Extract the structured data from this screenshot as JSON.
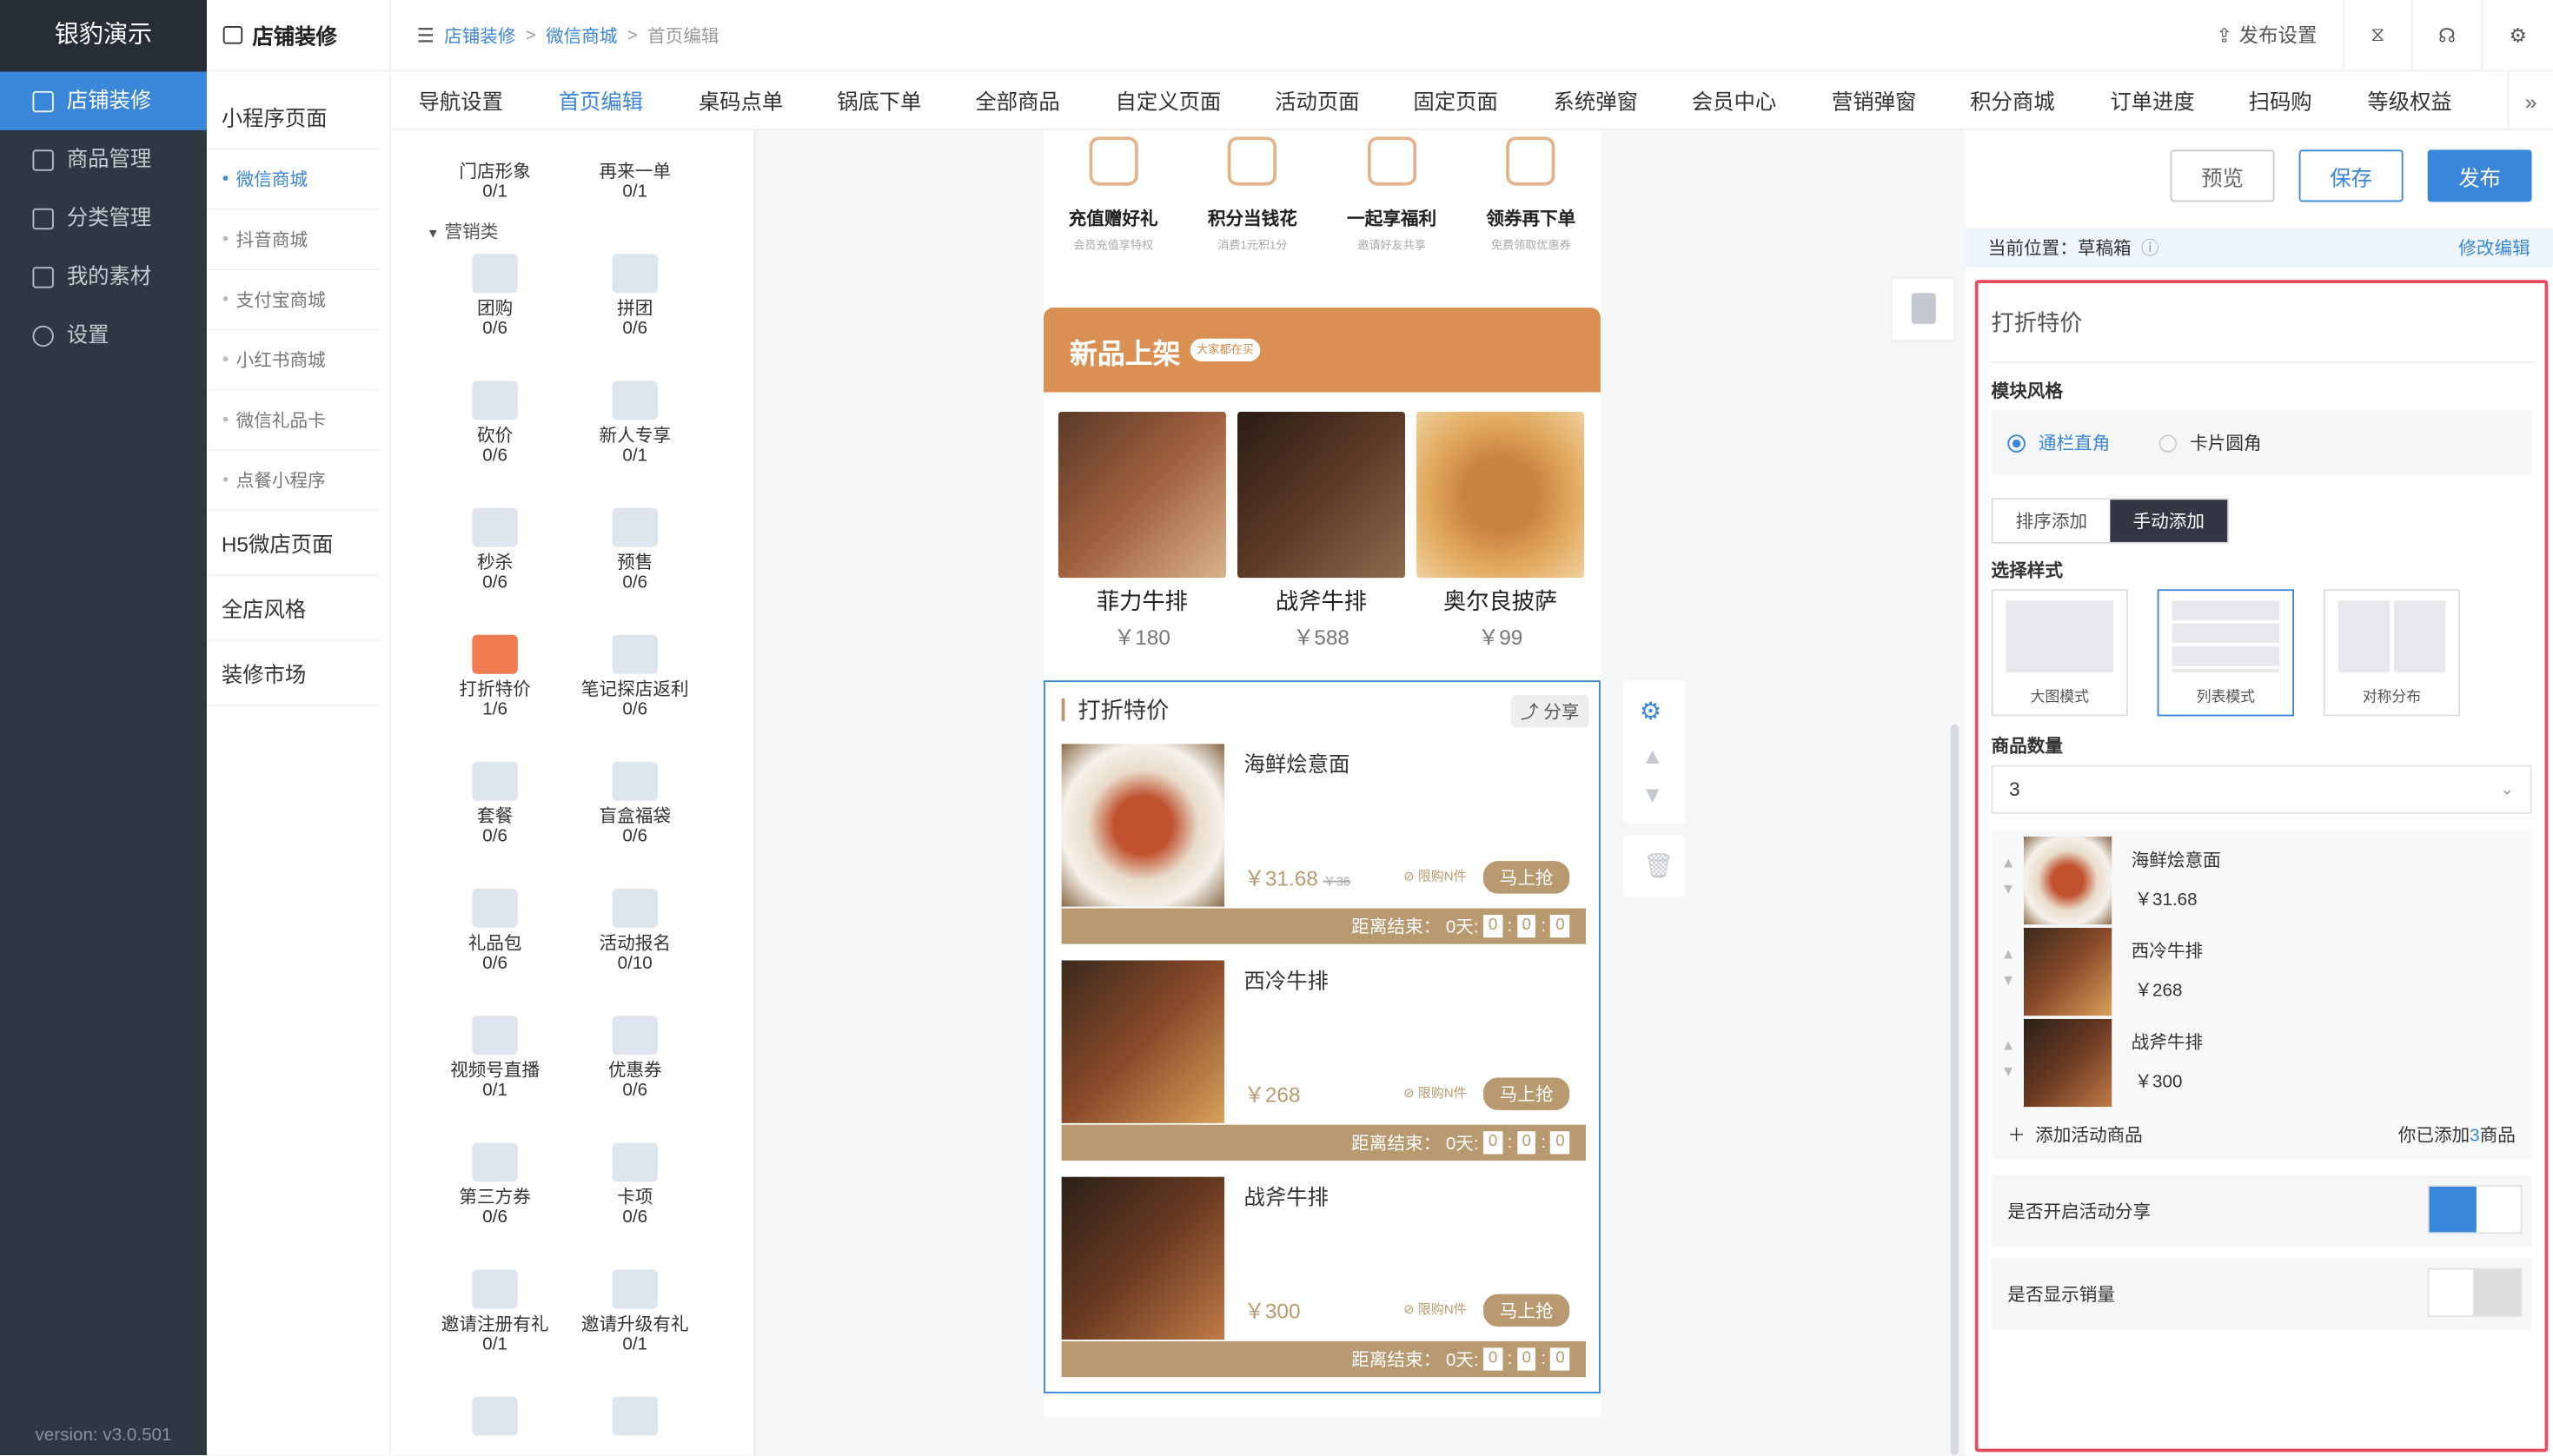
{
  "nav": {
    "brand": "银豹演示",
    "items": [
      {
        "label": "店铺装修",
        "active": true
      },
      {
        "label": "商品管理"
      },
      {
        "label": "分类管理"
      },
      {
        "label": "我的素材"
      },
      {
        "label": "设置"
      }
    ],
    "version": "version: v3.0.501"
  },
  "sub": {
    "title": "店铺装修",
    "groups": [
      {
        "label": "小程序页面",
        "links": [
          "微信商城",
          "抖音商城",
          "支付宝商城",
          "小红书商城",
          "微信礼品卡",
          "点餐小程序"
        ]
      }
    ],
    "others": [
      "H5微店页面",
      "全店风格",
      "装修市场"
    ]
  },
  "breadcrumb": [
    "店铺装修",
    "微信商城",
    "首页编辑"
  ],
  "topbar": {
    "publish_settings": "发布设置"
  },
  "tabs": [
    "导航设置",
    "首页编辑",
    "桌码点单",
    "锅底下单",
    "全部商品",
    "自定义页面",
    "活动页面",
    "固定页面",
    "系统弹窗",
    "会员中心",
    "营销弹窗",
    "积分商城",
    "订单进度",
    "扫码购",
    "等级权益"
  ],
  "components": {
    "top": [
      {
        "name": "门店形象",
        "count": "0/1"
      },
      {
        "name": "再来一单",
        "count": "0/1"
      }
    ],
    "category": "营销类",
    "items": [
      {
        "name": "团购",
        "count": "0/6"
      },
      {
        "name": "拼团",
        "count": "0/6"
      },
      {
        "name": "砍价",
        "count": "0/6"
      },
      {
        "name": "新人专享",
        "count": "0/1"
      },
      {
        "name": "秒杀",
        "count": "0/6"
      },
      {
        "name": "预售",
        "count": "0/6"
      },
      {
        "name": "打折特价",
        "count": "1/6"
      },
      {
        "name": "笔记探店返利",
        "count": "0/6"
      },
      {
        "name": "套餐",
        "count": "0/6"
      },
      {
        "name": "盲盒福袋",
        "count": "0/6"
      },
      {
        "name": "礼品包",
        "count": "0/6"
      },
      {
        "name": "活动报名",
        "count": "0/10"
      },
      {
        "name": "视频号直播",
        "count": "0/1"
      },
      {
        "name": "优惠券",
        "count": "0/6"
      },
      {
        "name": "第三方券",
        "count": "0/6"
      },
      {
        "name": "卡项",
        "count": "0/6"
      },
      {
        "name": "邀请注册有礼",
        "count": "0/1"
      },
      {
        "name": "邀请升级有礼",
        "count": "0/1"
      }
    ]
  },
  "preview": {
    "icons": [
      {
        "title": "充值赠好礼",
        "sub": "会员充值享特权"
      },
      {
        "title": "积分当钱花",
        "sub": "消费1元积1分"
      },
      {
        "title": "一起享福利",
        "sub": "邀请好友共享"
      },
      {
        "title": "领券再下单",
        "sub": "免费领取优惠券"
      }
    ],
    "new": {
      "title": "新品上架",
      "tag": "大家都在买",
      "items": [
        {
          "name": "菲力牛排",
          "price": "￥180"
        },
        {
          "name": "战斧牛排",
          "price": "￥588"
        },
        {
          "name": "奥尔良披萨",
          "price": "￥99"
        }
      ]
    },
    "deal": {
      "title": "打折特价",
      "share": "分享",
      "limit": "限购N件",
      "buy": "马上抢",
      "countdown": "距离结束：",
      "days": "0天:",
      "zero": "0",
      "items": [
        {
          "name": "海鲜烩意面",
          "price": "￥31.68",
          "old": "￥36"
        },
        {
          "name": "西冷牛排",
          "price": "￥268",
          "old": ""
        },
        {
          "name": "战斧牛排",
          "price": "￥300",
          "old": ""
        }
      ]
    }
  },
  "props": {
    "preview": "预览",
    "save": "保存",
    "publish": "发布",
    "location_label": "当前位置：草稿箱",
    "edit": "修改编辑",
    "title": "打折特价",
    "style_label": "模块风格",
    "style_opts": [
      "通栏直角",
      "卡片圆角"
    ],
    "add_modes": [
      "排序添加",
      "手动添加"
    ],
    "choose_style": "选择样式",
    "styles": [
      "大图模式",
      "列表模式",
      "对称分布"
    ],
    "qty_label": "商品数量",
    "qty": "3",
    "items": [
      {
        "name": "海鲜烩意面",
        "price": "￥31.68"
      },
      {
        "name": "西冷牛排",
        "price": "￥268"
      },
      {
        "name": "战斧牛排",
        "price": "￥300"
      }
    ],
    "add": "添加活动商品",
    "added_pre": "你已添加",
    "added_n": "3",
    "added_post": "商品",
    "share_toggle": "是否开启活动分享",
    "sales_toggle": "是否显示销量"
  }
}
